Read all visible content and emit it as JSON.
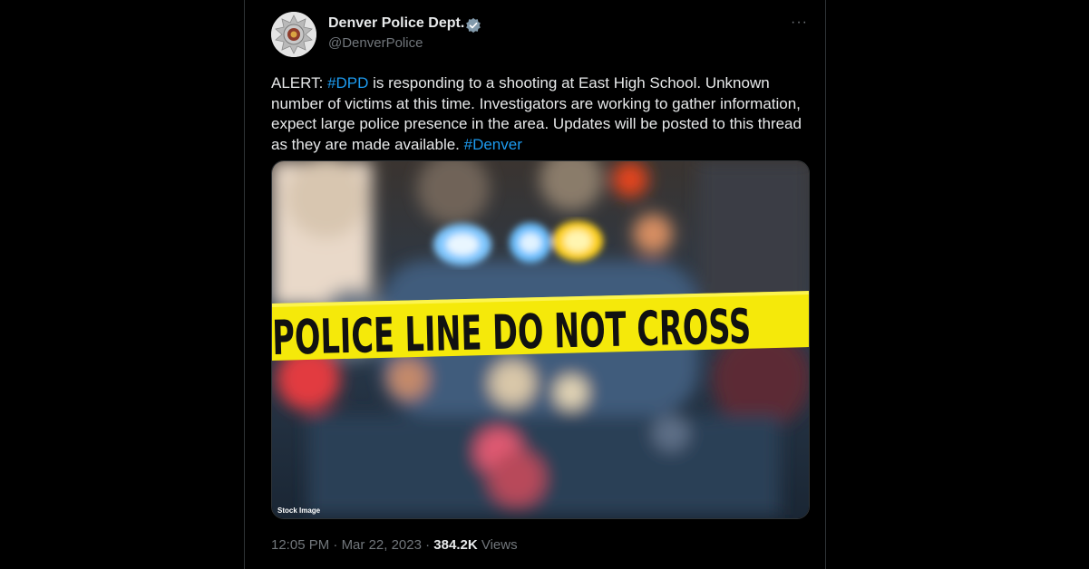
{
  "author": {
    "display_name": "Denver Police Dept.",
    "handle": "@DenverPolice",
    "avatar_icon": "police-badge-icon",
    "verified_icon": "verified-badge-icon",
    "verified_color": "#829aab"
  },
  "more_menu": {
    "label": "···"
  },
  "tweet": {
    "segments": [
      {
        "text": "ALERT: ",
        "type": "text"
      },
      {
        "text": "#DPD",
        "type": "hashtag"
      },
      {
        "text": " is responding to a shooting at East High School. Unknown number of victims at this time. Investigators are working to gather information, expect large police presence in the area. Updates will be posted to this thread as they are made available. ",
        "type": "text"
      },
      {
        "text": "#Denver",
        "type": "hashtag"
      }
    ]
  },
  "media": {
    "tape_text": "POLICE LINE DO NOT CROSS",
    "caption": "Stock Image"
  },
  "meta": {
    "time": "12:05 PM",
    "separator": "·",
    "date": "Mar 22, 2023",
    "views_count": "384.2K",
    "views_label": "Views"
  },
  "colors": {
    "background": "#000000",
    "text": "#e7e9ea",
    "secondary": "#71767b",
    "link": "#1d9bf0",
    "tape": "#f5e90a"
  }
}
